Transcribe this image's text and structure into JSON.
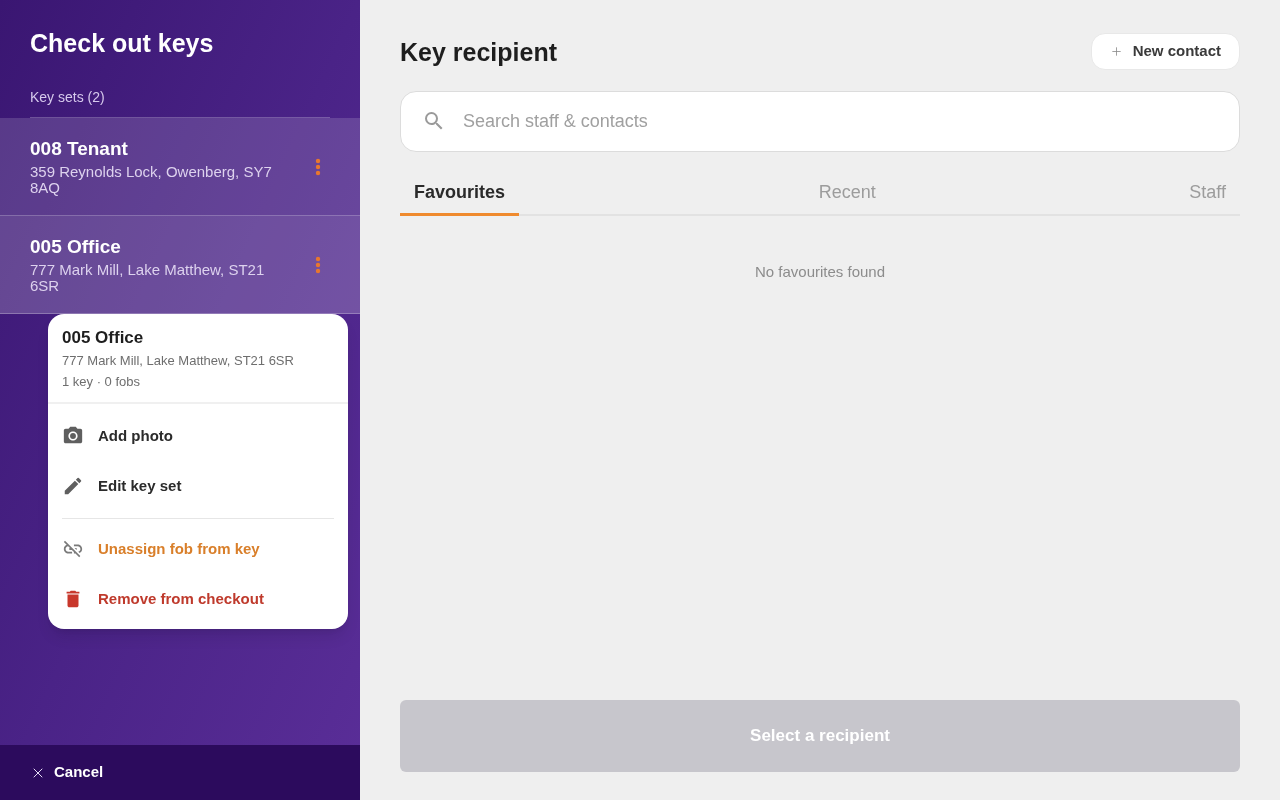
{
  "sidebar": {
    "title": "Check out keys",
    "section_label": "Key sets (2)",
    "key_sets": [
      {
        "name": "008 Tenant",
        "address": "359 Reynolds Lock, Owenberg, SY7 8AQ",
        "menu_open": false
      },
      {
        "name": "005 Office",
        "address": "777 Mark Mill, Lake Matthew, ST21 6SR",
        "menu_open": true
      }
    ],
    "cancel_button": "Cancel"
  },
  "context_menu": {
    "title": "005 Office",
    "address": "777 Mark Mill, Lake Matthew, ST21 6SR",
    "summary": "1 key · 0 fobs",
    "groups": [
      [
        {
          "label": "Add photo",
          "kind": "default"
        },
        {
          "label": "Edit key set",
          "kind": "default"
        }
      ],
      [
        {
          "label": "Unassign fob from key",
          "kind": "warning"
        },
        {
          "label": "Remove from checkout",
          "kind": "danger"
        }
      ]
    ]
  },
  "main": {
    "title": "Key recipient",
    "new_contact_button": "New contact",
    "search": {
      "placeholder": "Search staff & contacts"
    },
    "tabs": [
      {
        "label": "Favourites",
        "selected": true
      },
      {
        "label": "Recent",
        "selected": false
      },
      {
        "label": "Staff",
        "selected": false
      }
    ],
    "empty_message": "No favourites found",
    "select_button": {
      "label": "Select a recipient",
      "disabled": true
    }
  }
}
